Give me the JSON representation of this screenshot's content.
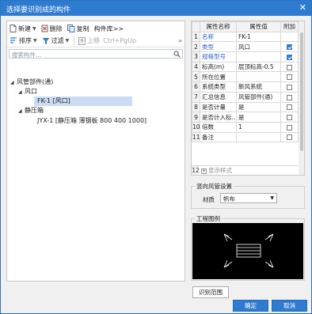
{
  "window": {
    "title": "选择要识别成的构件",
    "close_glyph": "✕"
  },
  "toolbar1": {
    "new_label": "新建",
    "delete_label": "删除",
    "copy_label": "复制",
    "library_label": "构件库>>"
  },
  "toolbar2": {
    "sort_label": "排序",
    "filter_label": "过滤",
    "move_up_label": "上移",
    "shortcut": "Ctrl+PgUp",
    "expand_glyph": "»"
  },
  "search": {
    "placeholder": "搜索构件..."
  },
  "tree": {
    "root": "风管部件(通)",
    "group1": "风口",
    "item1": "FK-1 [风口]",
    "group2": "静压箱",
    "item2": "JYX-1 [静压箱 薄钢板 800 400 1000]"
  },
  "props": {
    "headers": [
      "属性名称",
      "属性值",
      "附加"
    ],
    "rows": [
      {
        "n": "1",
        "name": "名称",
        "value": "FK-1",
        "check": false,
        "blue": true,
        "hascb": false
      },
      {
        "n": "2",
        "name": "类型",
        "value": "风口",
        "check": true,
        "blue": true,
        "hascb": true
      },
      {
        "n": "3",
        "name": "规格型号",
        "value": "",
        "check": true,
        "blue": true,
        "hascb": true
      },
      {
        "n": "4",
        "name": "标高(m)",
        "value": "层顶标高-0.5",
        "check": false,
        "blue": false,
        "hascb": true
      },
      {
        "n": "5",
        "name": "所在位置",
        "value": "",
        "check": false,
        "blue": false,
        "hascb": true
      },
      {
        "n": "6",
        "name": "系统类型",
        "value": "新风系统",
        "check": false,
        "blue": false,
        "hascb": true
      },
      {
        "n": "7",
        "name": "汇总信息",
        "value": "风管部件(通)",
        "check": false,
        "blue": false,
        "hascb": true
      },
      {
        "n": "8",
        "name": "是否计量",
        "value": "是",
        "check": false,
        "blue": false,
        "hascb": true
      },
      {
        "n": "9",
        "name": "是否计入标...",
        "value": "是",
        "check": false,
        "blue": false,
        "hascb": true
      },
      {
        "n": "10",
        "name": "倍数",
        "value": "1",
        "check": false,
        "blue": false,
        "hascb": true
      },
      {
        "n": "11",
        "name": "备注",
        "value": "",
        "check": false,
        "blue": false,
        "hascb": true
      }
    ],
    "show_row_num": "12",
    "show_label": "显示样式"
  },
  "duct": {
    "legend": "竖向风管设置",
    "material_label": "材质",
    "material_value": "帆布"
  },
  "preview": {
    "legend": "工程图例"
  },
  "buttons": {
    "range_label": "识别范围",
    "ok_label": "确定",
    "cancel_label": "取消"
  },
  "colors": {
    "titlebar": "#2f7bd0",
    "selection": "#c9dcf4",
    "accent_text": "#2c5fc8"
  }
}
